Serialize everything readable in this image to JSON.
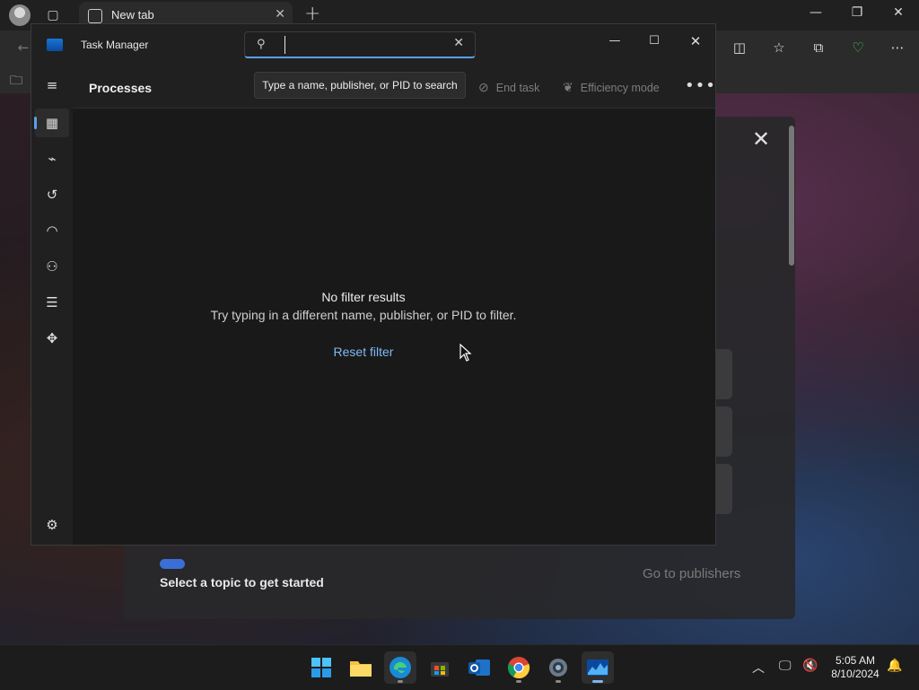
{
  "browser": {
    "tab_title": "New tab",
    "background": {
      "topic_text": "Select a topic to get started",
      "publishers_link": "Go to publishers"
    }
  },
  "task_manager": {
    "title": "Task Manager",
    "search": {
      "value": "",
      "placeholder": ""
    },
    "tooltip": "Type a name, publisher, or PID to search",
    "page_title": "Processes",
    "commands": {
      "end_task": "End task",
      "efficiency_mode": "Efficiency mode",
      "more": "•••"
    },
    "empty_state": {
      "title": "No filter results",
      "subtitle": "Try typing in a different name, publisher, or PID to filter.",
      "reset": "Reset filter"
    },
    "nav_items": [
      {
        "name": "processes",
        "icon": "processes-icon",
        "selected": true
      },
      {
        "name": "performance",
        "icon": "performance-icon"
      },
      {
        "name": "app-history",
        "icon": "history-icon"
      },
      {
        "name": "startup-apps",
        "icon": "speedometer-icon"
      },
      {
        "name": "users",
        "icon": "users-icon"
      },
      {
        "name": "details",
        "icon": "list-icon"
      },
      {
        "name": "services",
        "icon": "puzzle-icon"
      },
      {
        "name": "settings",
        "icon": "gear-icon"
      }
    ]
  },
  "taskbar": {
    "apps": [
      "start",
      "file-explorer",
      "edge",
      "microsoft-store",
      "outlook",
      "chrome",
      "settings",
      "task-manager"
    ],
    "active_app": "task-manager",
    "clock": {
      "time": "5:05 AM",
      "date": "8/10/2024"
    }
  },
  "colors": {
    "accent": "#5aa0e6",
    "link": "#7fbaf5",
    "window_bg": "#191919",
    "chrome_bg": "#202020"
  }
}
